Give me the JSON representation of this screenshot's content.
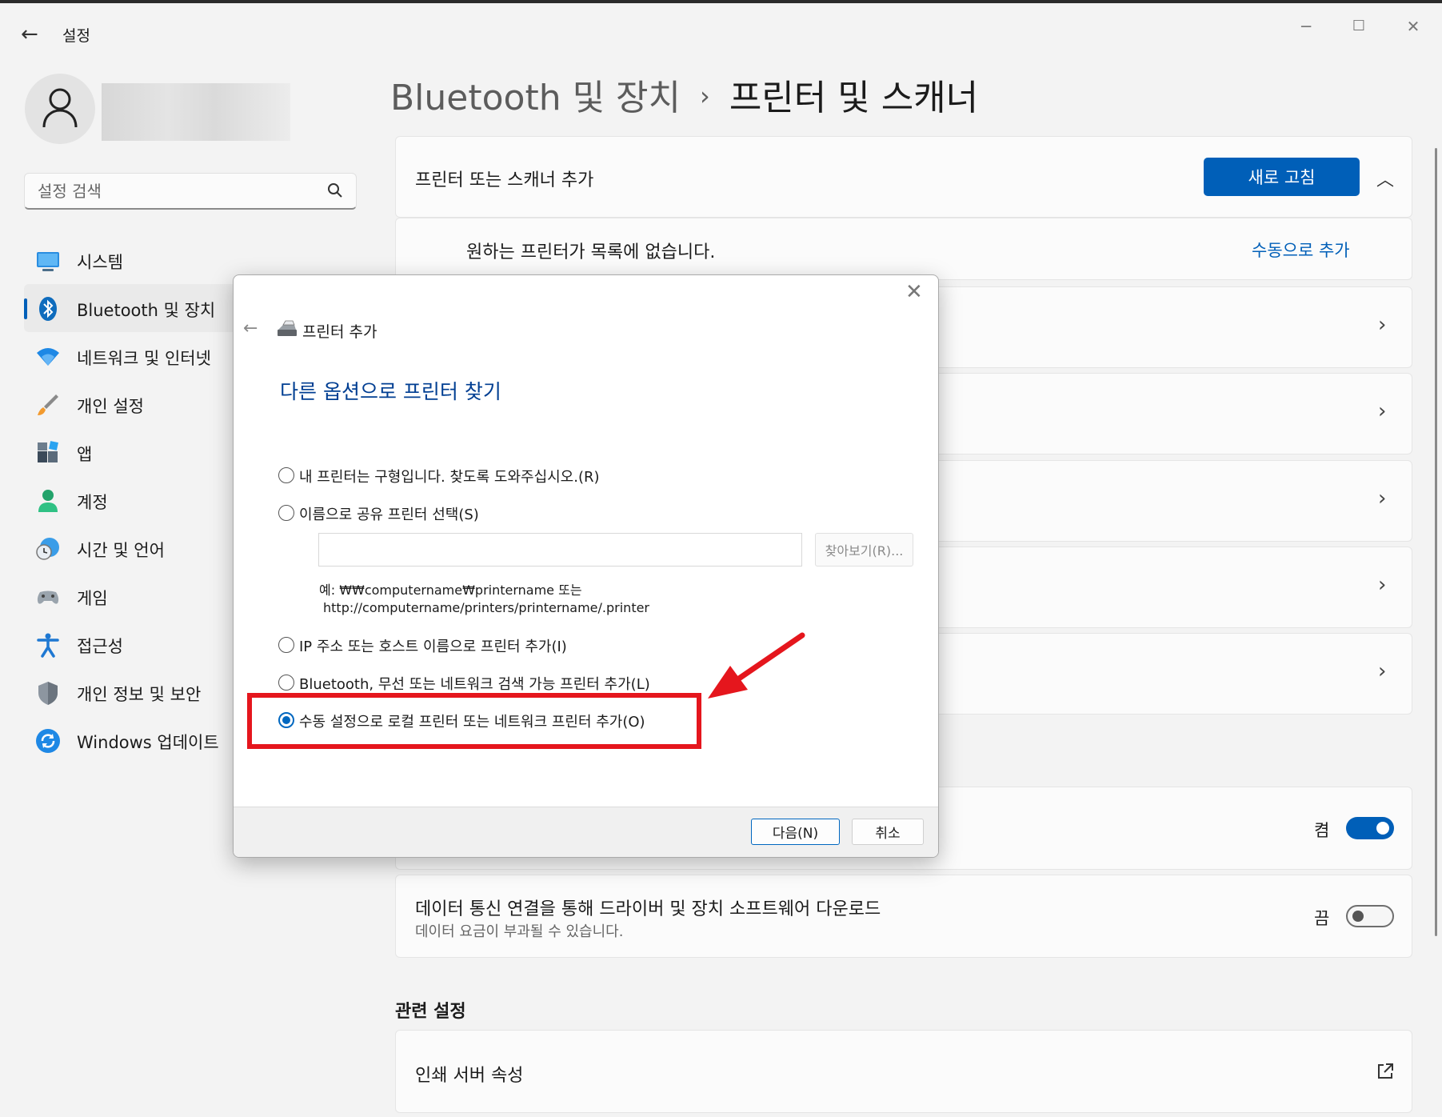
{
  "window": {
    "title": "설정",
    "back_icon": "arrow-left-icon",
    "controls": {
      "minimize": "─",
      "maximize": "☐",
      "close": "✕"
    }
  },
  "search": {
    "placeholder": "설정 검색",
    "icon": "search-icon"
  },
  "sidebar": {
    "items": [
      {
        "label": "시스템",
        "icon": "monitor-icon"
      },
      {
        "label": "Bluetooth 및 장치",
        "icon": "bluetooth-icon",
        "active": true
      },
      {
        "label": "네트워크 및 인터넷",
        "icon": "wifi-icon"
      },
      {
        "label": "개인 설정",
        "icon": "brush-icon"
      },
      {
        "label": "앱",
        "icon": "apps-icon"
      },
      {
        "label": "계정",
        "icon": "person-icon"
      },
      {
        "label": "시간 및 언어",
        "icon": "clock-globe-icon"
      },
      {
        "label": "게임",
        "icon": "gamepad-icon"
      },
      {
        "label": "접근성",
        "icon": "accessibility-icon"
      },
      {
        "label": "개인 정보 및 보안",
        "icon": "shield-icon"
      },
      {
        "label": "Windows 업데이트",
        "icon": "update-icon"
      }
    ]
  },
  "breadcrumb": {
    "parent": "Bluetooth 및 장치",
    "separator": "›",
    "current": "프린터 및 스캐너"
  },
  "add_device": {
    "title": "프린터 또는 스캐너 추가",
    "refresh_label": "새로 고침",
    "not_listed_text": "원하는 프린터가 목록에 없습니다.",
    "manual_add_link": "수동으로 추가"
  },
  "toggles": {
    "first": {
      "state_label": "켬",
      "on": true
    },
    "metered": {
      "title": "데이터 통신 연결을 통해 드라이버 및 장치 소프트웨어 다운로드",
      "subtitle": "데이터 요금이 부과될 수 있습니다.",
      "state_label": "끔",
      "on": false
    }
  },
  "related": {
    "title": "관련 설정",
    "print_server": "인쇄 서버 속성",
    "external_icon": "external-link-icon"
  },
  "dialog": {
    "title": "프린터 추가",
    "heading": "다른 옵션으로 프린터 찾기",
    "options": {
      "old_printer": "내 프린터는 구형입니다. 찾도록 도와주십시오.(R)",
      "shared_by_name": "이름으로 공유 프린터 선택(S)",
      "ip_or_host": "IP 주소 또는 호스트 이름으로 프린터 추가(I)",
      "bluetooth_wireless": "Bluetooth, 무선 또는 네트워크 검색 가능 프린터 추가(L)",
      "manual_local": "수동 설정으로 로컬 프린터 또는 네트워크 프린터 추가(O)"
    },
    "selected_option": "manual_local",
    "share_input_value": "",
    "browse_label": "찾아보기(R)...",
    "example_line1": "예: ₩₩computername₩printername 또는",
    "example_line2": "http://computername/printers/printername/.printer",
    "next_label": "다음(N)",
    "cancel_label": "취소",
    "close_icon": "close-icon",
    "back_icon": "arrow-left-icon",
    "printer_icon": "printer-icon"
  },
  "annotation": {
    "highlight_color": "#e5161d",
    "arrow_color": "#e5161d"
  },
  "colors": {
    "accent": "#005fb8",
    "dialog_heading": "#003e92"
  }
}
